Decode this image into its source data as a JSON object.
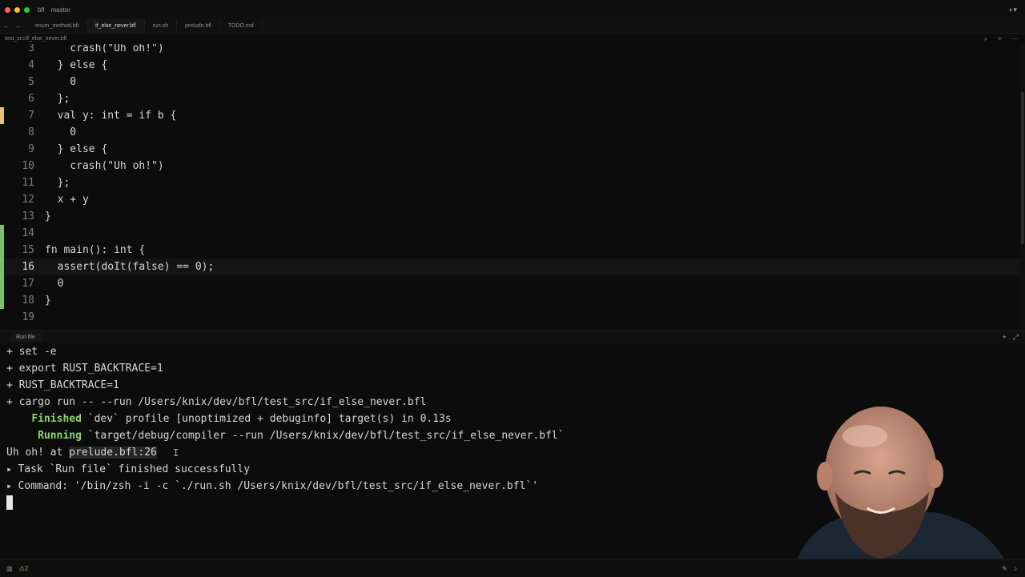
{
  "titlebar": {
    "project": "bfl",
    "branch": "master",
    "traffic_lights": [
      "#ff5f57",
      "#febc2e",
      "#28c840"
    ]
  },
  "tabs": [
    {
      "label": "enum_method.bfl",
      "active": false
    },
    {
      "label": "if_else_never.bfl",
      "active": true
    },
    {
      "label": "run.sh",
      "active": false
    },
    {
      "label": "prelude.bfl",
      "active": false
    },
    {
      "label": "TODO.md",
      "active": false
    }
  ],
  "breadcrumb": "test_src/if_else_never.bfl",
  "editor": {
    "current_line": "16",
    "lines": [
      {
        "num": "3",
        "text": "    crash(\"Uh oh!\")"
      },
      {
        "num": "4",
        "text": "  } else {"
      },
      {
        "num": "5",
        "text": "    0"
      },
      {
        "num": "6",
        "text": "  };"
      },
      {
        "num": "7",
        "text": "  val y: int = if b {"
      },
      {
        "num": "8",
        "text": "    0"
      },
      {
        "num": "9",
        "text": "  } else {"
      },
      {
        "num": "10",
        "text": "    crash(\"Uh oh!\")"
      },
      {
        "num": "11",
        "text": "  };"
      },
      {
        "num": "12",
        "text": "  x + y"
      },
      {
        "num": "13",
        "text": "}"
      },
      {
        "num": "14",
        "text": ""
      },
      {
        "num": "15",
        "text": "fn main(): int {"
      },
      {
        "num": "16",
        "text": "  assert(doIt(false) == 0);"
      },
      {
        "num": "17",
        "text": "  0"
      },
      {
        "num": "18",
        "text": "}"
      },
      {
        "num": "19",
        "text": ""
      }
    ],
    "colors": {
      "modified": "#e5c07b",
      "added": "#7fbf6a"
    }
  },
  "panel": {
    "tab_label": "Run file",
    "add_icon": "plus-icon",
    "expand_icon": "expand-icon"
  },
  "terminal": {
    "l1": "+ set -e",
    "l2": "+ export RUST_BACKTRACE=1",
    "l3": "+ RUST_BACKTRACE=1",
    "l4": "+ cargo run -- --run /Users/knix/dev/bfl/test_src/if_else_never.bfl",
    "l5_kw": "Finished",
    "l5_rest": " `dev` profile [unoptimized + debuginfo] target(s) in 0.13s",
    "l6_kw": "Running",
    "l6_rest": " `target/debug/compiler --run /Users/knix/dev/bfl/test_src/if_else_never.bfl`",
    "l7_prefix": "Uh oh! at ",
    "l7_loc": "prelude.bfl:26",
    "l8": "Task `Run file` finished successfully",
    "l9": "Command: '/bin/zsh -i -c `./run.sh /Users/knix/dev/bfl/test_src/if_else_never.bfl`'"
  },
  "statusbar": {
    "warnings": "2"
  }
}
